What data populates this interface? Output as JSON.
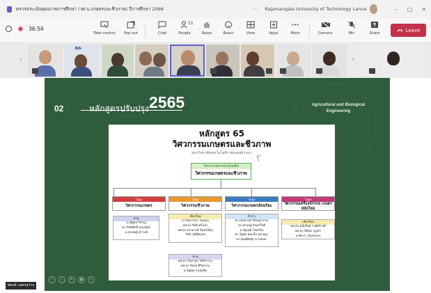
{
  "window": {
    "title": "ตรวจประเมินคุณภาพการศึกษา (วศ.บ.เกษตรและชีวภาพ) ปีการศึกษา 2566",
    "more": "···",
    "org": "Rajamangala University of Technology Lanna",
    "controls": {
      "minimize": "–",
      "maximize": "□",
      "close": "✕"
    }
  },
  "toolbar": {
    "timer": "36:54",
    "buttons": [
      {
        "label": "Take control"
      },
      {
        "label": "Pop out"
      },
      {
        "label": "Chat"
      },
      {
        "label": "People",
        "count": "11"
      },
      {
        "label": "Raise"
      },
      {
        "label": "React"
      },
      {
        "label": "View"
      },
      {
        "label": "Apps"
      },
      {
        "label": "More"
      },
      {
        "label": "Camera"
      },
      {
        "label": "Mic"
      },
      {
        "label": "Share"
      }
    ],
    "leave": "Leave"
  },
  "participants": {
    "tile_label": "BA",
    "prev_arrow": "‹",
    "next_arrow": "›"
  },
  "slide": {
    "number": "02",
    "title_th": "หลักสูตรปรับปรุง",
    "title_year": "2565",
    "department": [
      "Agricultural and Biological",
      "Engineering"
    ],
    "heading1": "หลักสูตร 65",
    "heading2": "วิศวกรรมเกษตรและชีวภาพ",
    "heading3": "มหาวิทยาลัยเทคโนโลยีราชมงคลล้านนา",
    "degree_top": "วิศวกรรมศาสตรบัณฑิต",
    "degree_main": "วิศวกรรมเกษตรและชีวภาพ",
    "track_caption": "โมดูล",
    "tracks": [
      "วิศวกรรมเกษตร",
      "วิศวกรรมชีวภาพ",
      "วิศวกรรมเกษตรอัจฉริยะ",
      "วิศวกรรมเครื่องจักรกล เกษตรสมัยใหม่"
    ],
    "box1": {
      "head": "น่าน",
      "lines": [
        "อ.ณัฐพล วิชาญ",
        "ดร.กิตติศักดิ์ ธนะนิตย์",
        "อ.สุรเชษฐ์ คำวงศ์"
      ]
    },
    "box2": {
      "head": "เชียงใหม่",
      "lines": [
        "ดร.นิสรรวยา โยมหุน",
        "ผศ.ดร.กิตต์ ศรีแสง",
        "ผศ.ดร.ธรรมรงค์ จันทร์เพ็ญ",
        "รัชนี วุฒิชัยเดช"
      ]
    },
    "box3": {
      "head": "ลำปาง",
      "lines": [
        "ดร.เศกสรรค์ เรือนสุวรรณ",
        "ดร.สุกฤษฏ์ จันทร์ใจดี",
        "อ.ณัฐวุฒิ ไชยเรือง",
        "ดร.รัฐพล คนแข็ง ผศ.ชฎา",
        "ดร.พฤฒิพิชญ์ นาไชยยา"
      ]
    },
    "box4": {
      "head": "เชียงใหม่",
      "lines": [
        "ผศ.ดร.ดนัยวิทย์ วงษ์ศรีวงศ์",
        "ผศ.ดร.นิธิพล บุญชา",
        "อ.ชัยวรา จันทร์แสง"
      ]
    },
    "box5": {
      "head": "น่าน",
      "lines": [
        "ผศ.ดร.กันยาพร โชติวรรณ",
        "ผศ.ดร.วิศรุต ศิริพรรณ",
        "อ.ณัฐพล ถนอมจิต"
      ]
    }
  },
  "presenter": {
    "name": "พยงค์ เนตรสว่าง"
  },
  "colors": {
    "slide_bg": "#2f5c3c",
    "leave_red": "#c4314b",
    "track1": "#d13f3f",
    "track2": "#e89a2f",
    "track3": "#3a7bbf",
    "track4": "#c23a7a",
    "degree_border": "#4caf50"
  }
}
